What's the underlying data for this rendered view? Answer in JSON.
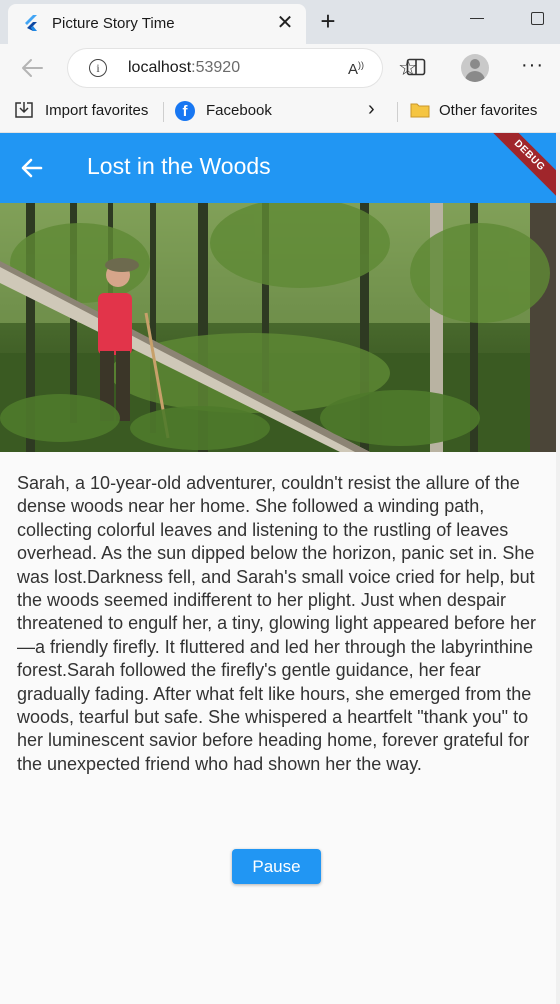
{
  "browser": {
    "tab_title": "Picture Story Time",
    "url_host": "localhost",
    "url_port": ":53920",
    "favorites": [
      {
        "label": "Import favorites",
        "icon": "import-icon"
      },
      {
        "label": "Facebook",
        "icon": "facebook-icon"
      },
      {
        "label": "Other favorites",
        "icon": "folder-icon"
      }
    ]
  },
  "app": {
    "title": "Lost in the Woods",
    "debug_label": "DEBUG",
    "primary_color": "#2196f3",
    "story_text": "Sarah, a 10-year-old adventurer, couldn't resist the allure of the dense woods near her home. She followed a winding path, collecting colorful leaves and listening to the rustling of leaves overhead. As the sun dipped below the horizon, panic set in. She was lost.Darkness fell, and Sarah's small voice cried for help, but the woods seemed indifferent to her plight. Just when despair threatened to engulf her, a tiny, glowing light appeared before her—a friendly firefly. It fluttered and led her through the labyrinthine forest.Sarah followed the firefly's gentle guidance, her fear gradually fading. After what felt like hours, she emerged from the woods, tearful but safe. She whispered a heartfelt \"thank you\" to her luminescent savior before heading home, forever grateful for the unexpected friend who had shown her the way.",
    "pause_label": "Pause"
  }
}
